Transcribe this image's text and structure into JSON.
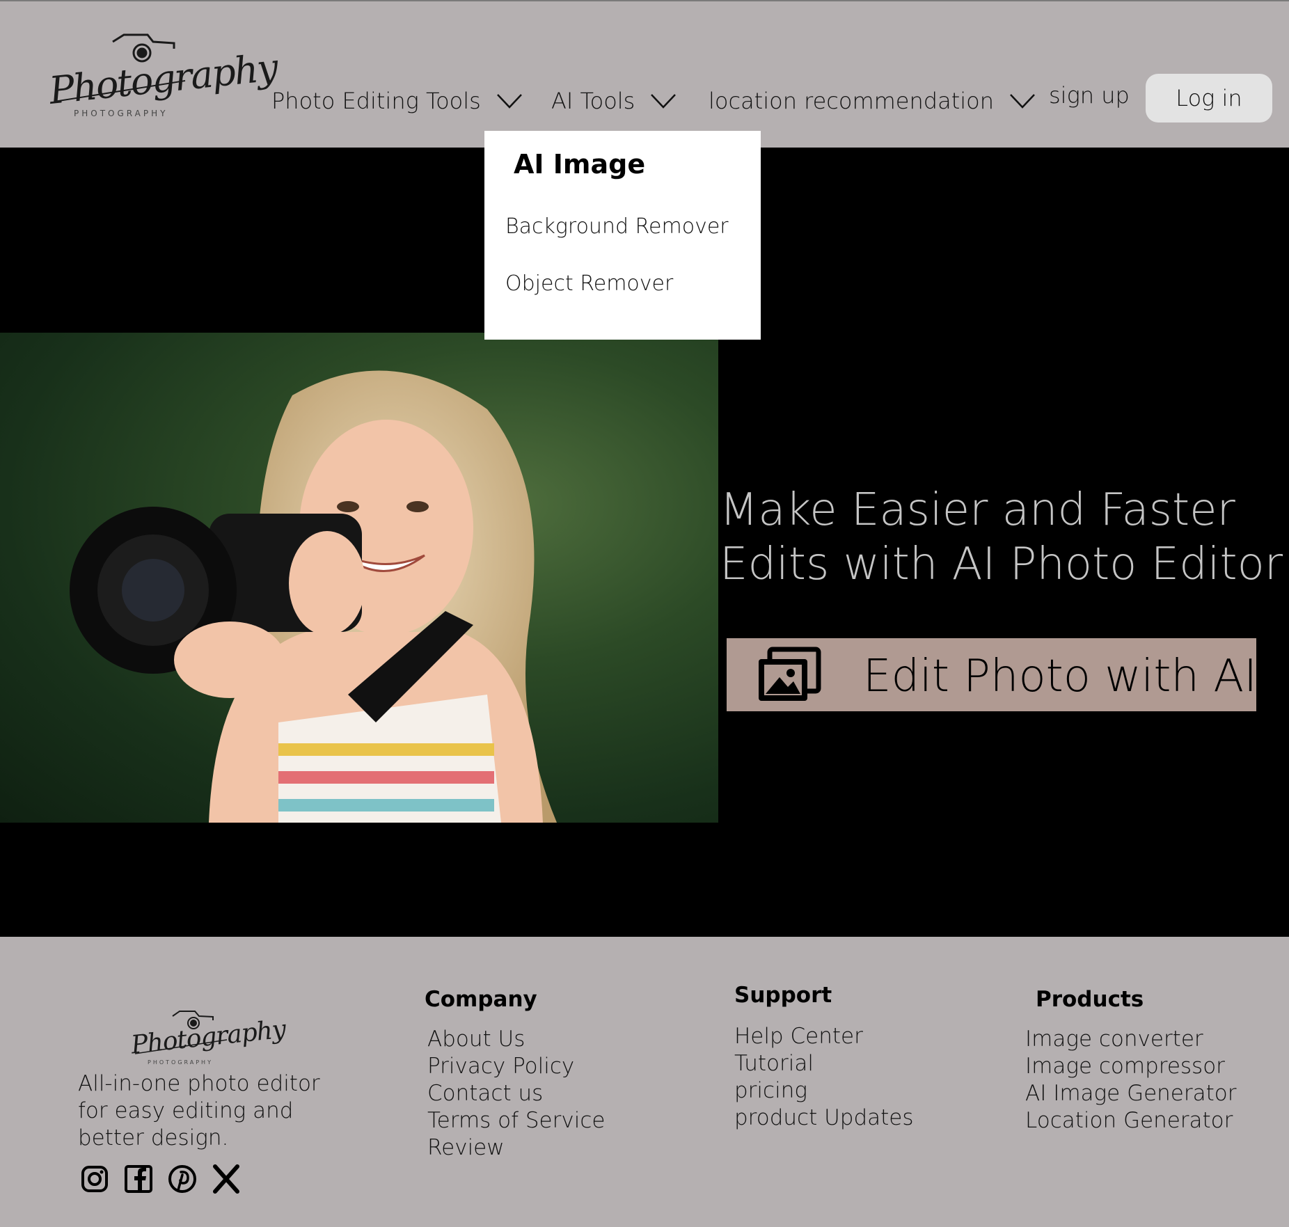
{
  "brand": {
    "logo_script": "Photography",
    "logo_sub": "PHOTOGRAPHY"
  },
  "nav": {
    "photo_editing_tools": "Photo Editing Tools",
    "ai_tools": "AI Tools",
    "location_recommendation": "location recommendation",
    "sign_up": "sign up",
    "log_in": "Log in"
  },
  "dropdown": {
    "heading": "AI Image",
    "items": [
      "Background Remover",
      "Object Remover"
    ]
  },
  "hero": {
    "title_line1": "Make Easier and Faster",
    "title_line2": "Edits with AI Photo Editor",
    "cta_label": "Edit Photo with AI",
    "cta_icon": "photo-gallery-icon"
  },
  "footer": {
    "tagline": "All-in-one photo editor for easy editing and better design.",
    "social_icons": [
      "instagram-icon",
      "facebook-icon",
      "pinterest-icon",
      "x-icon"
    ],
    "company": {
      "title": "Company",
      "links": [
        "About Us",
        "Privacy Policy",
        "Contact us",
        "Terms of Service",
        "Review"
      ]
    },
    "support": {
      "title": "Support",
      "links": [
        "Help Center",
        "Tutorial",
        "pricing",
        "product Updates"
      ]
    },
    "products": {
      "title": "Products",
      "links": [
        "Image converter",
        "Image compressor",
        "AI Image Generator",
        "Location Generator"
      ]
    }
  },
  "colors": {
    "header_bg": "#b5b0b1",
    "hero_bg": "#000000",
    "cta_bg": "#b09a92",
    "login_bg": "#e3e3e3",
    "hero_text": "#c5c5c5"
  }
}
